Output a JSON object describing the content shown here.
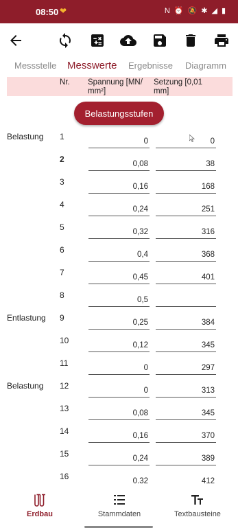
{
  "status_bar": {
    "time": "08:50",
    "icons": [
      "nfc-icon",
      "alarm-icon",
      "mute-icon",
      "bluetooth-icon",
      "signal-icon",
      "battery-icon"
    ]
  },
  "toolbar": {
    "icons": [
      "back-arrow-icon",
      "sync-icon",
      "calculator-icon",
      "cloud-upload-icon",
      "save-icon",
      "delete-icon",
      "print-icon"
    ]
  },
  "tabs": [
    {
      "label": "Messstelle",
      "active": false
    },
    {
      "label": "Messwerte",
      "active": true
    },
    {
      "label": "Ergebnisse",
      "active": false
    },
    {
      "label": "Diagramm",
      "active": false
    }
  ],
  "column_header": {
    "nr": "Nr.",
    "spannung": "Spannung [MN/\nmm²]",
    "setzung": "Setzung [0,01\nmm]"
  },
  "belastungsstufen_button": "Belastungsstufen",
  "rows": [
    {
      "phase": "Belastung",
      "nr": "1",
      "spannung": "0",
      "setzung": "0",
      "bold": false
    },
    {
      "phase": "",
      "nr": "2",
      "spannung": "0,08",
      "setzung": "38",
      "bold": true
    },
    {
      "phase": "",
      "nr": "3",
      "spannung": "0,16",
      "setzung": "168",
      "bold": false
    },
    {
      "phase": "",
      "nr": "4",
      "spannung": "0,24",
      "setzung": "251",
      "bold": false
    },
    {
      "phase": "",
      "nr": "5",
      "spannung": "0,32",
      "setzung": "316",
      "bold": false
    },
    {
      "phase": "",
      "nr": "6",
      "spannung": "0,4",
      "setzung": "368",
      "bold": false
    },
    {
      "phase": "",
      "nr": "7",
      "spannung": "0,45",
      "setzung": "401",
      "bold": false
    },
    {
      "phase": "",
      "nr": "8",
      "spannung": "0,5",
      "setzung": "",
      "bold": false
    },
    {
      "phase": "Entlastung",
      "nr": "9",
      "spannung": "0,25",
      "setzung": "384",
      "bold": false
    },
    {
      "phase": "",
      "nr": "10",
      "spannung": "0,12",
      "setzung": "345",
      "bold": false
    },
    {
      "phase": "",
      "nr": "11",
      "spannung": "0",
      "setzung": "297",
      "bold": false
    },
    {
      "phase": "Belastung",
      "nr": "12",
      "spannung": "0",
      "setzung": "313",
      "bold": false
    },
    {
      "phase": "",
      "nr": "13",
      "spannung": "0,08",
      "setzung": "345",
      "bold": false
    },
    {
      "phase": "",
      "nr": "14",
      "spannung": "0,16",
      "setzung": "370",
      "bold": false
    },
    {
      "phase": "",
      "nr": "15",
      "spannung": "0,24",
      "setzung": "389",
      "bold": false
    },
    {
      "phase": "",
      "nr": "16",
      "spannung": "0.32",
      "setzung": "412",
      "bold": false
    }
  ],
  "bottom_nav": [
    {
      "label": "Erdbau",
      "icon": "test-tubes-icon",
      "active": true
    },
    {
      "label": "Stammdaten",
      "icon": "list-icon",
      "active": false
    },
    {
      "label": "Textbausteine",
      "icon": "text-size-icon",
      "active": false
    }
  ],
  "colors": {
    "brand": "#8e1d2a",
    "button": "#a3202f",
    "header_bg": "#fbdcdc",
    "tab_inactive": "#8a8a8a"
  }
}
